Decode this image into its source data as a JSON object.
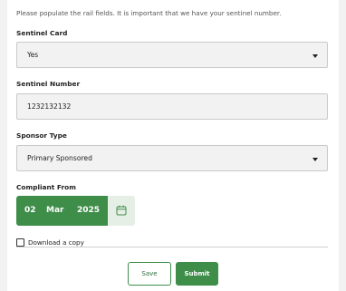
{
  "form": {
    "instructions": "Please populate the rail fields.  It is important that we have your sentinel number.",
    "sentinel_card": {
      "label": "Sentinel Card",
      "value": "Yes"
    },
    "sentinel_number": {
      "label": "Sentinel Number",
      "value": "1232132132"
    },
    "sponsor_type": {
      "label": "Sponsor Type",
      "value": "Primary Sponsored"
    },
    "compliant_from": {
      "label": "Compliant From",
      "day": "02",
      "month": "Mar",
      "year": "2025"
    },
    "download_copy": {
      "label": "Download a copy",
      "checked": false
    },
    "buttons": {
      "save": "Save",
      "submit": "Submit"
    }
  },
  "colors": {
    "primary": "#3e8e4a",
    "calendar_bg": "#e6efe6",
    "field_bg": "#f2f2f2",
    "page_bg": "#f2f2f2"
  },
  "icons": {
    "calendar": "calendar-icon",
    "dropdown": "chevron-down-icon"
  }
}
